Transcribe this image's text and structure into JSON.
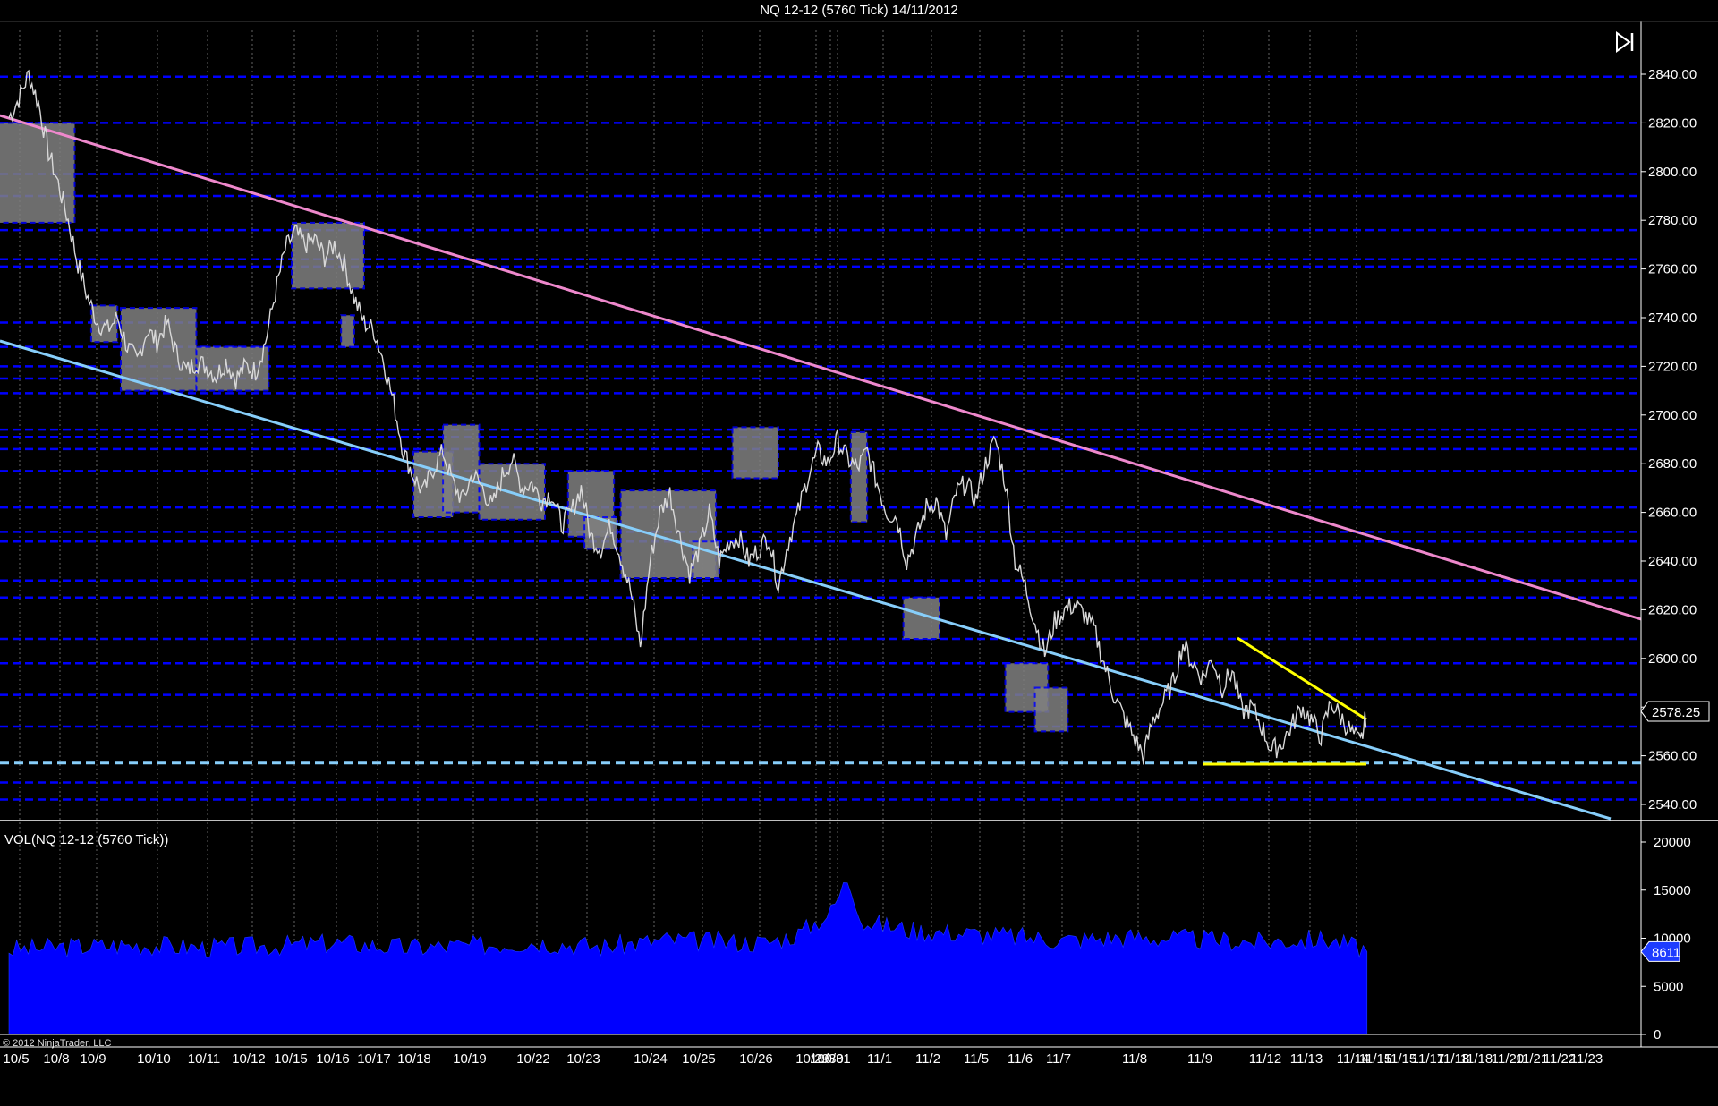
{
  "chart_title": "NQ 12-12 (5760 Tick)  14/11/2012",
  "volume_panel_title": "VOL(NQ 12-12 (5760 Tick))",
  "copyright": "© 2012 NinjaTrader, LLC",
  "colors": {
    "background": "#000000",
    "price_bar": "#d8d8d8",
    "volume": "#0000ff",
    "gridline": "#b0b0b0",
    "level_line": "#0000ff",
    "support_dashed": "#87cefa",
    "upper_trendline": "#ee88cc",
    "lower_trendline": "#87cefa",
    "triangle": "#ffff00",
    "value_area_box": "#808080"
  },
  "chart_data": [
    {
      "type": "line",
      "name": "price",
      "ylim": [
        2530,
        2845
      ],
      "y_ticks": [
        "2840.00",
        "2820.00",
        "2800.00",
        "2780.00",
        "2760.00",
        "2740.00",
        "2720.00",
        "2700.00",
        "2680.00",
        "2660.00",
        "2640.00",
        "2620.00",
        "2600.00",
        "2580.00",
        "2560.00",
        "2540.00"
      ],
      "x_ticks": [
        "10/5",
        "10/8",
        "10/9",
        "10/10",
        "10/11",
        "10/12",
        "10/15",
        "10/16",
        "10/17",
        "10/18",
        "10/19",
        "10/22",
        "10/23",
        "10/24",
        "10/25",
        "10/26",
        "10/29",
        "10/30",
        "10/31",
        "11/1",
        "11/2",
        "11/5",
        "11/6",
        "11/7",
        "11/8",
        "11/9",
        "11/12",
        "11/13",
        "11/14",
        "11/15",
        "11/15",
        "11/17",
        "11/18",
        "11/18",
        "11/20",
        "11/21",
        "11/22",
        "11/23"
      ],
      "last_price": "2578.25",
      "price_path": [
        [
          0,
          2822
        ],
        [
          3,
          2830
        ],
        [
          6,
          2840
        ],
        [
          9,
          2828
        ],
        [
          12,
          2808
        ],
        [
          15,
          2795
        ],
        [
          18,
          2780
        ],
        [
          21,
          2762
        ],
        [
          24,
          2748
        ],
        [
          27,
          2738
        ],
        [
          30,
          2735
        ],
        [
          33,
          2740
        ],
        [
          36,
          2728
        ],
        [
          39,
          2722
        ],
        [
          42,
          2735
        ],
        [
          45,
          2730
        ],
        [
          48,
          2738
        ],
        [
          51,
          2725
        ],
        [
          54,
          2718
        ],
        [
          57,
          2722
        ],
        [
          60,
          2720
        ],
        [
          63,
          2716
        ],
        [
          66,
          2722
        ],
        [
          69,
          2715
        ],
        [
          72,
          2720
        ],
        [
          75,
          2718
        ],
        [
          78,
          2730
        ],
        [
          81,
          2750
        ],
        [
          84,
          2768
        ],
        [
          87,
          2775
        ],
        [
          90,
          2770
        ],
        [
          93,
          2772
        ],
        [
          96,
          2765
        ],
        [
          99,
          2770
        ],
        [
          102,
          2762
        ],
        [
          105,
          2748
        ],
        [
          108,
          2738
        ],
        [
          111,
          2735
        ],
        [
          114,
          2722
        ],
        [
          117,
          2705
        ],
        [
          120,
          2685
        ],
        [
          123,
          2675
        ],
        [
          126,
          2668
        ],
        [
          129,
          2678
        ],
        [
          132,
          2685
        ],
        [
          135,
          2672
        ],
        [
          138,
          2665
        ],
        [
          141,
          2676
        ],
        [
          144,
          2670
        ],
        [
          147,
          2662
        ],
        [
          150,
          2675
        ],
        [
          153,
          2682
        ],
        [
          156,
          2670
        ],
        [
          159,
          2672
        ],
        [
          162,
          2665
        ],
        [
          165,
          2668
        ],
        [
          168,
          2655
        ],
        [
          171,
          2660
        ],
        [
          174,
          2670
        ],
        [
          177,
          2650
        ],
        [
          180,
          2645
        ],
        [
          183,
          2655
        ],
        [
          186,
          2642
        ],
        [
          189,
          2628
        ],
        [
          192,
          2605
        ],
        [
          195,
          2640
        ],
        [
          198,
          2660
        ],
        [
          201,
          2668
        ],
        [
          204,
          2650
        ],
        [
          207,
          2635
        ],
        [
          210,
          2645
        ],
        [
          213,
          2660
        ],
        [
          216,
          2640
        ],
        [
          219,
          2648
        ],
        [
          222,
          2650
        ],
        [
          225,
          2640
        ],
        [
          228,
          2645
        ],
        [
          231,
          2650
        ],
        [
          234,
          2630
        ],
        [
          237,
          2648
        ],
        [
          240,
          2660
        ],
        [
          243,
          2675
        ],
        [
          246,
          2685
        ],
        [
          249,
          2680
        ],
        [
          252,
          2690
        ],
        [
          255,
          2682
        ],
        [
          258,
          2678
        ],
        [
          261,
          2685
        ],
        [
          264,
          2672
        ],
        [
          267,
          2660
        ],
        [
          270,
          2658
        ],
        [
          273,
          2640
        ],
        [
          276,
          2650
        ],
        [
          279,
          2662
        ],
        [
          282,
          2665
        ],
        [
          285,
          2650
        ],
        [
          288,
          2668
        ],
        [
          291,
          2672
        ],
        [
          294,
          2665
        ],
        [
          297,
          2680
        ],
        [
          300,
          2690
        ],
        [
          303,
          2672
        ],
        [
          306,
          2640
        ],
        [
          309,
          2630
        ],
        [
          312,
          2615
        ],
        [
          315,
          2602
        ],
        [
          318,
          2615
        ],
        [
          321,
          2620
        ],
        [
          324,
          2622
        ],
        [
          327,
          2618
        ],
        [
          330,
          2612
        ],
        [
          333,
          2598
        ],
        [
          336,
          2585
        ],
        [
          339,
          2576
        ],
        [
          342,
          2568
        ],
        [
          345,
          2560
        ],
        [
          348,
          2575
        ],
        [
          351,
          2582
        ],
        [
          354,
          2590
        ],
        [
          357,
          2606
        ],
        [
          360,
          2598
        ],
        [
          363,
          2592
        ],
        [
          366,
          2600
        ],
        [
          369,
          2588
        ],
        [
          372,
          2595
        ],
        [
          375,
          2578
        ],
        [
          378,
          2580
        ],
        [
          381,
          2572
        ],
        [
          384,
          2562
        ],
        [
          387,
          2565
        ],
        [
          390,
          2572
        ],
        [
          393,
          2580
        ],
        [
          396,
          2575
        ],
        [
          399,
          2568
        ],
        [
          402,
          2582
        ],
        [
          405,
          2576
        ],
        [
          408,
          2570
        ],
        [
          411,
          2565
        ],
        [
          413,
          2578
        ]
      ]
    },
    {
      "type": "bar",
      "name": "volume",
      "ylim": [
        0,
        22000
      ],
      "y_ticks": [
        "20000",
        "15000",
        "10000",
        "5000",
        "0"
      ],
      "last_volume": "8611",
      "volume_path": [
        [
          0,
          8600
        ],
        [
          20,
          8900
        ],
        [
          40,
          9100
        ],
        [
          60,
          8800
        ],
        [
          80,
          9000
        ],
        [
          100,
          9300
        ],
        [
          120,
          8800
        ],
        [
          140,
          9000
        ],
        [
          160,
          9400
        ],
        [
          180,
          8900
        ],
        [
          200,
          9600
        ],
        [
          230,
          9300
        ],
        [
          240,
          10200
        ],
        [
          250,
          12500
        ],
        [
          255,
          16000
        ],
        [
          260,
          11500
        ],
        [
          275,
          10600
        ],
        [
          290,
          10300
        ],
        [
          300,
          10100
        ],
        [
          320,
          9600
        ],
        [
          340,
          9900
        ],
        [
          360,
          9700
        ],
        [
          380,
          9400
        ],
        [
          400,
          9700
        ],
        [
          413,
          8611
        ]
      ]
    }
  ]
}
